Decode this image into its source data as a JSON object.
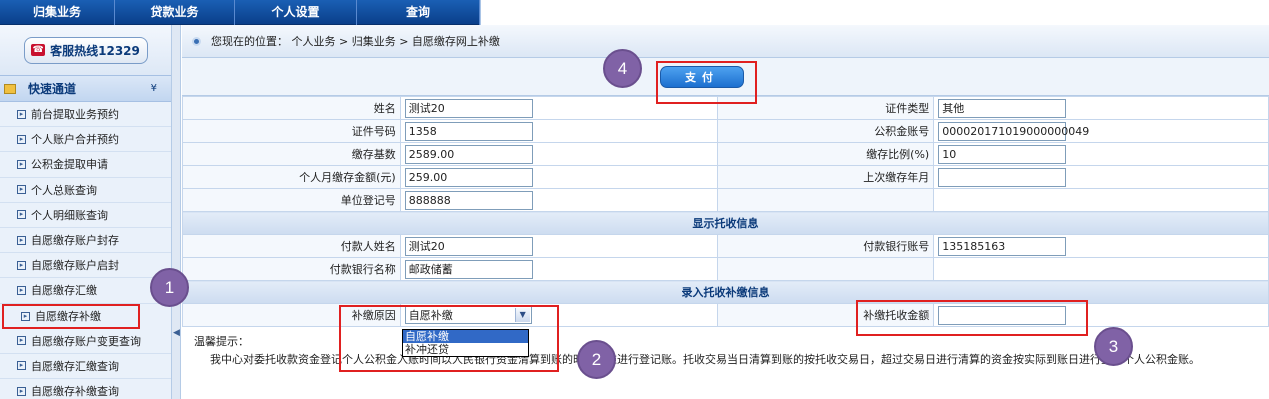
{
  "nav": {
    "items": [
      "归集业务",
      "贷款业务",
      "个人设置",
      "查询"
    ]
  },
  "sidebar": {
    "hotline": "客服热线12329",
    "quick_title": "快速通道",
    "items": [
      "前台提取业务预约",
      "个人账户合并预约",
      "公积金提取申请",
      "个人总账查询",
      "个人明细账查询",
      "自愿缴存账户封存",
      "自愿缴存账户启封",
      "自愿缴存汇缴",
      "自愿缴存补缴",
      "自愿缴存账户变更查询",
      "自愿缴存汇缴查询",
      "自愿缴存补缴查询"
    ]
  },
  "breadcrumb": "您现在的位置： 个人业务 > 归集业务 > 自愿缴存网上补缴",
  "pay_button": "支付",
  "fields": {
    "name_label": "姓名",
    "name_value": "测试20",
    "id_type_label": "证件类型",
    "id_type_value": "其他",
    "id_no_label": "证件号码",
    "id_no_value": "1358",
    "account_label": "公积金账号",
    "account_value": "000020171019000000049",
    "base_label": "缴存基数",
    "base_value": "2589.00",
    "ratio_label": "缴存比例(%)",
    "ratio_value": "10",
    "monthly_label": "个人月缴存金额(元)",
    "monthly_value": "259.00",
    "last_month_label": "上次缴存年月",
    "last_month_value": "",
    "unit_reg_label": "单位登记号",
    "unit_reg_value": "888888"
  },
  "section_collect": "显示托收信息",
  "collect": {
    "payer_name_label": "付款人姓名",
    "payer_name_value": "测试20",
    "bank_acct_label": "付款银行账号",
    "bank_acct_value": "135185163",
    "bank_name_label": "付款银行名称",
    "bank_name_value": "邮政储蓄"
  },
  "section_entry": "录入托收补缴信息",
  "entry": {
    "reason_label": "补缴原因",
    "reason_selected": "自愿补缴",
    "reason_options": [
      "自愿补缴",
      "补冲还贷"
    ],
    "amount_label": "补缴托收金额",
    "amount_value": ""
  },
  "tips": {
    "title": "温馨提示：",
    "body": "我中心对委托收款资金登记个人公积金入账时间以人民银行资金清算到账的时间为准进行登记账。托收交易当日清算到账的按托收交易日，超过交易日进行清算的资金按实际到账日进行登记个人公积金账。"
  },
  "annotations": [
    "1",
    "2",
    "3",
    "4"
  ],
  "colors": {
    "nav": "#1a5fb4",
    "highlight": "#e02020",
    "badge": "#8062a6",
    "dropdown_selected": "#3169c6"
  }
}
